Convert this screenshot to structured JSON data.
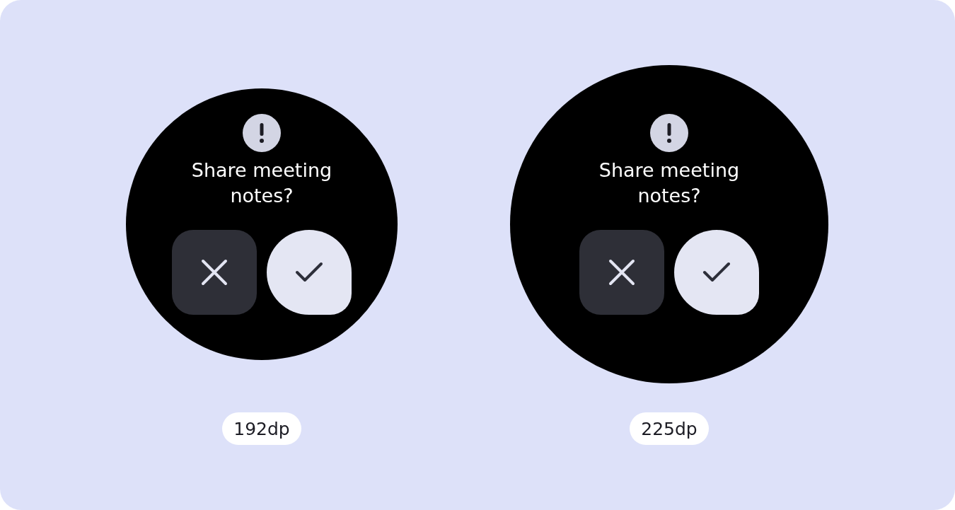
{
  "watches": [
    {
      "title": "Share meeting notes?",
      "size_label": "192dp",
      "buttons": [
        {
          "kind": "dismiss"
        },
        {
          "kind": "confirm"
        }
      ]
    },
    {
      "title": "Share meeting notes?",
      "size_label": "225dp",
      "buttons": [
        {
          "kind": "dismiss"
        },
        {
          "kind": "confirm"
        }
      ]
    }
  ]
}
